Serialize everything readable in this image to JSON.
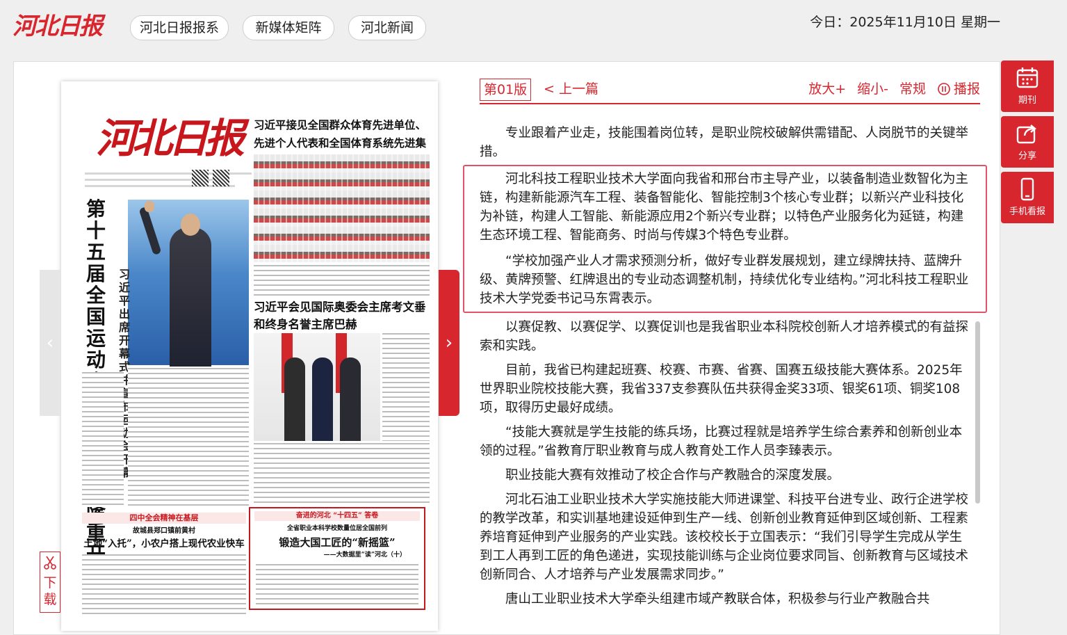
{
  "header": {
    "logo_text": "河北日报",
    "nav": [
      "河北日报报系",
      "新媒体矩阵",
      "河北新闻"
    ],
    "date_text": "今日：2025年11月10日 星期一"
  },
  "paper": {
    "masthead": "河北日报",
    "headline_vertical": "第十五届全国运动会在广东广州隆重开幕",
    "sub_vertical": "习近平出席开幕式并宣布运动会开幕",
    "right_headline": "习近平接见全国群众体育先进单位、先进个人代表和全国体育系统先进集体、先进个人代表",
    "mid_headline": "习近平会见国际奥委会主席考文垂和终身名誉主席巴赫",
    "band_label": "四中全会精神在基层",
    "left_sub_kicker": "故城县郑口镇前黄村",
    "left_sub_title": "土地“入托”，小农户搭上现代农业快车",
    "box_kicker": "奋进的河北 “十四五” 答卷",
    "box_lead": "全省职业本科学校数量位居全国前列",
    "box_title": "锻造大国工匠的“新摇篮”",
    "box_sub": "——大数据里“读”河北（十）"
  },
  "nav_arrows": {
    "left": "‹",
    "right": "›"
  },
  "download_label": "下载",
  "toolbar": {
    "edition": "第01版",
    "prev": "< 上一篇",
    "zoom_in": "放大+",
    "zoom_out": "缩小-",
    "normal": "常规",
    "broadcast": "播报"
  },
  "article": {
    "paragraphs": [
      "专业跟着产业走，技能围着岗位转，是职业院校破解供需错配、人岗脱节的关键举措。",
      "河北科技工程职业技术大学面向我省和邢台市主导产业，以装备制造业数智化为主链，构建新能源汽车工程、装备智能化、智能控制3个核心专业群；以新兴产业科技化为补链，构建人工智能、新能源应用2个新兴专业群；以特色产业服务化为延链，构建生态环境工程、智能商务、时尚与传媒3个特色专业群。",
      "“学校加强产业人才需求预测分析，做好专业群发展规划，建立绿牌扶持、蓝牌升级、黄牌预警、红牌退出的专业动态调整机制，持续优化专业结构。”河北科技工程职业技术大学党委书记马东霄表示。",
      "以赛促教、以赛促学、以赛促训也是我省职业本科院校创新人才培养模式的有益探索和实践。",
      "目前，我省已构建起班赛、校赛、市赛、省赛、国赛五级技能大赛体系。2025年世界职业院校技能大赛，我省337支参赛队伍共获得金奖33项、银奖61项、铜奖108项，取得历史最好成绩。",
      "“技能大赛就是学生技能的练兵场，比赛过程就是培养学生综合素养和创新创业本领的过程。”省教育厅职业教育与成人教育处工作人员李臻表示。",
      "职业技能大赛有效推动了校企合作与产教融合的深度发展。",
      "河北石油工业职业技术大学实施技能大师进课堂、科技平台进专业、政行企进学校的教学改革，和实训基地建设延伸到生产一线、创新创业教育延伸到区域创新、工程素养培育延伸到产业服务的产业实践。该校校长于立国表示：“我们引导学生完成从学生到工人再到工匠的角色递进，实现技能训练与企业岗位要求同旨、创新教育与区域技术创新同合、人才培养与产业发展需求同步。”",
      "唐山工业职业技术大学牵头组建市域产教联合体，积极参与行业产教融合共"
    ]
  },
  "side_tabs": [
    "期刊",
    "分享",
    "手机看报"
  ],
  "colors": {
    "brand_red": "#d8262f",
    "highlight_border": "#e0526a"
  }
}
